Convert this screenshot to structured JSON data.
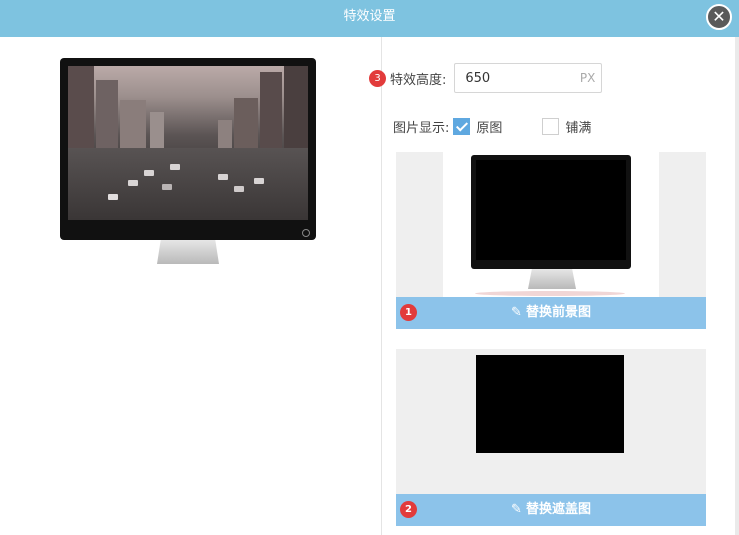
{
  "dialog": {
    "title": "特效设置",
    "close_glyph": "✕"
  },
  "settings": {
    "badge_height": "3",
    "height_label": "特效高度:",
    "height_value": "650",
    "height_unit": "PX",
    "display_label": "图片显示:",
    "display_options": [
      {
        "label": "原图",
        "checked": true
      },
      {
        "label": "铺满",
        "checked": false
      }
    ]
  },
  "foreground": {
    "badge": "1",
    "button_label": "替换前景图",
    "icon": "edit-icon"
  },
  "mask": {
    "badge": "2",
    "button_label": "替换遮盖图",
    "icon": "edit-icon"
  },
  "colors": {
    "titlebar": "#7ec3e0",
    "action_bar": "#8cc3ea",
    "badge": "#e23b3b",
    "checkbox_checked": "#5fa8e0"
  }
}
